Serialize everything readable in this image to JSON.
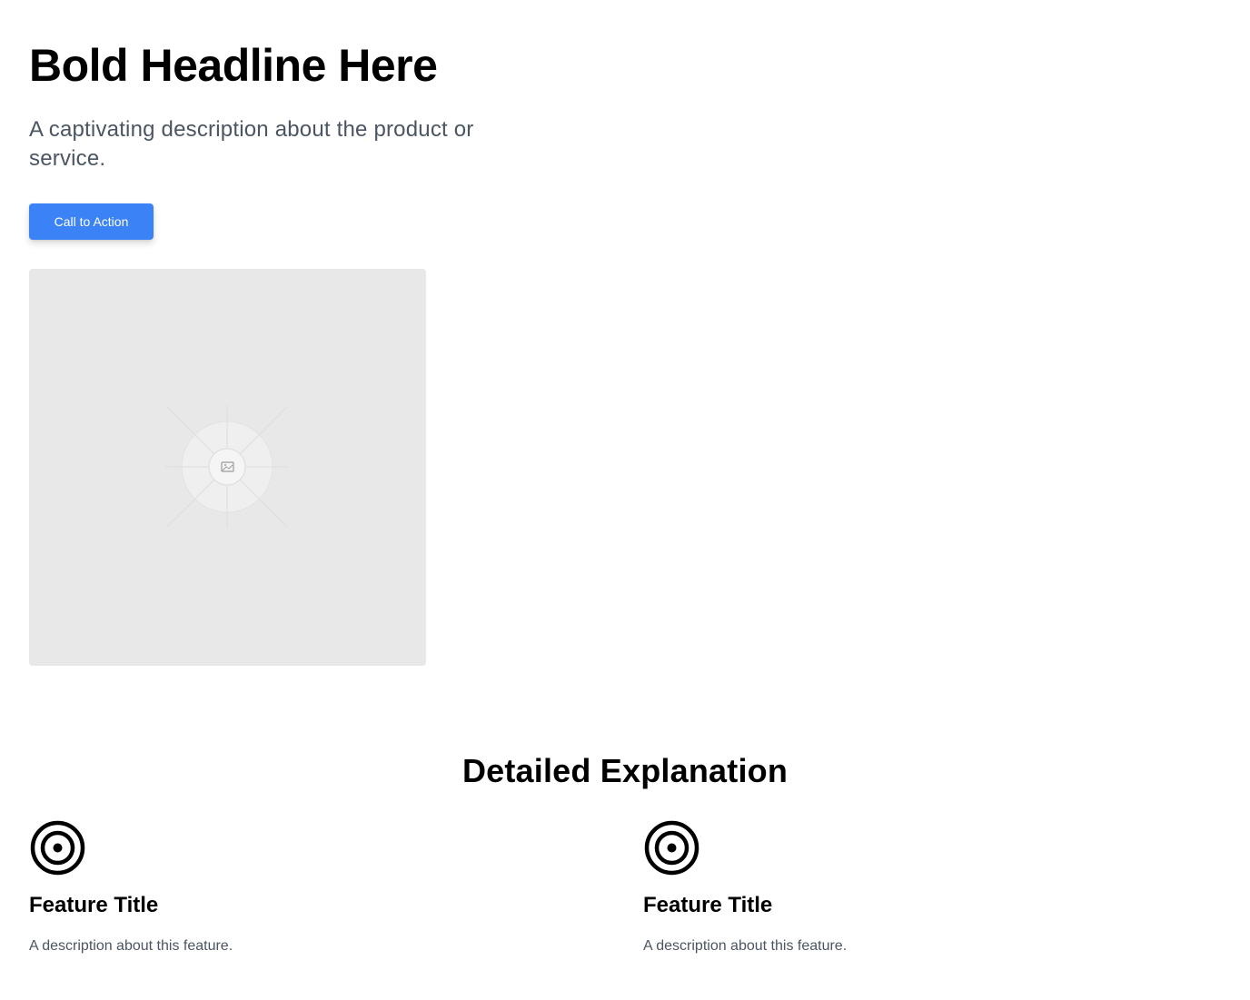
{
  "hero": {
    "headline": "Bold Headline Here",
    "description": "A captivating description about the product or service.",
    "cta_label": "Call to Action",
    "image_icon": "image-icon"
  },
  "details": {
    "section_title": "Detailed Explanation",
    "features": [
      {
        "icon": "target-icon",
        "title": "Feature Title",
        "description": "A description about this feature."
      },
      {
        "icon": "target-icon",
        "title": "Feature Title",
        "description": "A description about this feature."
      }
    ]
  },
  "colors": {
    "accent": "#3b82f6",
    "text_primary": "#000000",
    "text_secondary": "#4b5563",
    "placeholder_bg": "#e8e8e8"
  }
}
